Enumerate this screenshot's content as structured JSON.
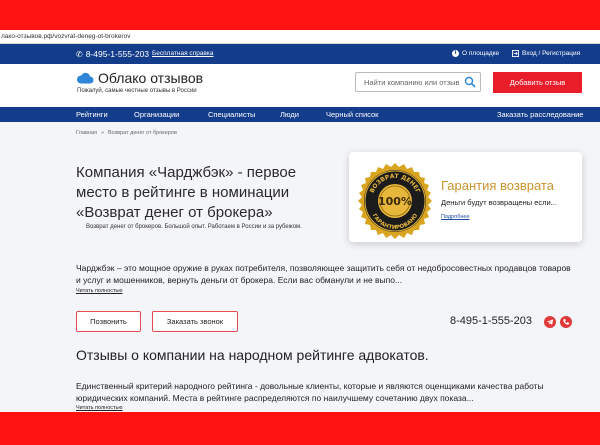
{
  "url": "лако-отзывов.рф/vozvrat-deneg-ot-brokerov",
  "topbar": {
    "phone": "8-495-1-555-203",
    "consult_label": "Бесплатная справка",
    "about_label": "О площадке",
    "login_label": "Вход / Регистрация"
  },
  "header": {
    "logo_title": "Облако отзывов",
    "tagline": "Пожалуй, самые честные отзывы в России",
    "search_placeholder": "Найти компанию или отзыв",
    "add_review_label": "Добавить отзыв"
  },
  "nav": {
    "items": [
      "Рейтинги",
      "Организации",
      "Специалисты",
      "Люди",
      "Черный список"
    ],
    "order_investigation": "Заказать расследование"
  },
  "breadcrumb": {
    "home": "Главная",
    "separator": "»",
    "current": "Возврат денег от брокеров"
  },
  "main": {
    "title": "Компания «Чарджбэк» - первое место в рейтинге в номинации «Возврат денег от брокера»",
    "subtitle": "Возврат денег от брокеров. Большой опыт. Работаем в России и за рубежом.",
    "description": "Чарджбэк – это мощное оружие в руках потребителя, позволяющее защитить себя от недобросовестных продавцов товаров и услуг и мошенников, вернуть деньги от брокера. Если вас обманули и не выпо...",
    "read_more": "Читать полностью",
    "call_label": "Позвонить",
    "order_call_label": "Заказать звонок",
    "contact_phone": "8-495-1-555-203"
  },
  "guarantee": {
    "seal_top": "ВОЗВРАТ ДЕНЕГ",
    "seal_center": "100%",
    "seal_bottom": "ГАРАНТИРОВАНО",
    "title": "Гарантия возврата",
    "text": "Деньги будут возвращены если...",
    "link": "Подробнее"
  },
  "section2": {
    "title": "Отзывы о компании на народном рейтинге адвокатов.",
    "description": "Единственный критерий народного рейтинга - довольные клиенты, которые и являются оценщиками качества работы юридических компаний. Места в рейтинге распределяются по наилучшему сочетанию двух показа...",
    "read_more": "Читать полностью"
  },
  "colors": {
    "red_bar": "#ff1212",
    "navy": "#133c8b",
    "accent_red": "#ea1d2b",
    "gold": "#c9932b"
  },
  "icons": [
    "phone-icon",
    "info-icon",
    "login-icon",
    "cloud-logo-icon",
    "search-icon",
    "telegram-icon",
    "call-icon"
  ]
}
